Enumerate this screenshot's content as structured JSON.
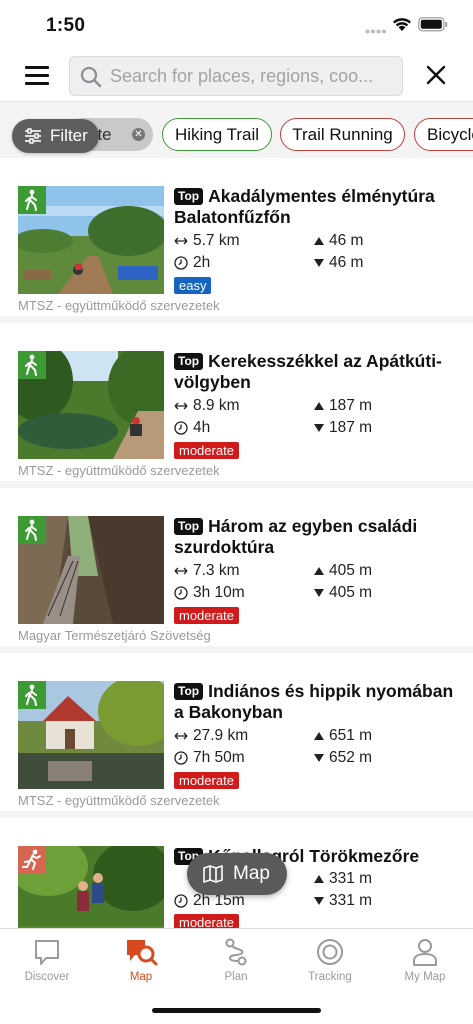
{
  "status_bar": {
    "time": "1:50"
  },
  "search": {
    "placeholder": "Search for places, regions, coo..."
  },
  "chips": {
    "route_partial": "ute",
    "filter_label": "Filter",
    "hiking": "Hiking Trail",
    "running": "Trail Running",
    "bicycle": "Bicycle"
  },
  "tours": [
    {
      "top_tag": "Top",
      "title": "Akadálymentes élménytúra Balatonfűzfőn",
      "distance": "5.7 km",
      "duration": "2h",
      "ascent": "46 m",
      "descent": "46 m",
      "difficulty": "easy",
      "source": "MTSZ - együttműködő szervezetek",
      "activity_icon": "hiking-icon"
    },
    {
      "top_tag": "Top",
      "title": "Kerekesszékkel az Apátkúti-völgyben",
      "distance": "8.9 km",
      "duration": "4h",
      "ascent": "187 m",
      "descent": "187 m",
      "difficulty": "moderate",
      "source": "MTSZ - együttműködő szervezetek",
      "activity_icon": "hiking-icon"
    },
    {
      "top_tag": "Top",
      "title": "Három az egyben családi szurdoktúra",
      "distance": "7.3 km",
      "duration": "3h 10m",
      "ascent": "405 m",
      "descent": "405 m",
      "difficulty": "moderate",
      "source": "Magyar Természetjáró Szövetség",
      "activity_icon": "hiking-icon"
    },
    {
      "top_tag": "Top",
      "title": "Indiános és hippik nyomában a Bakonyban",
      "distance": "27.9 km",
      "duration": "7h 50m",
      "ascent": "651 m",
      "descent": "652 m",
      "difficulty": "moderate",
      "source": "MTSZ - együttműködő szervezetek",
      "activity_icon": "hiking-icon"
    },
    {
      "top_tag": "Top",
      "title": "Kőpallagról Törökmezőre",
      "distance": "",
      "duration": "2h 15m",
      "ascent": "331 m",
      "descent": "331 m",
      "difficulty": "moderate",
      "source": "",
      "activity_icon": "running-icon"
    }
  ],
  "map_button": {
    "label": "Map"
  },
  "tabbar": {
    "discover": "Discover",
    "map": "Map",
    "plan": "Plan",
    "tracking": "Tracking",
    "my_map": "My Map",
    "active": "map"
  },
  "colors": {
    "hiking_green": "#3d9a35",
    "running_red": "#c0403a",
    "easy_blue": "#1565c0",
    "moderate_red": "#d11a1a",
    "active_tab": "#d64a1e"
  }
}
